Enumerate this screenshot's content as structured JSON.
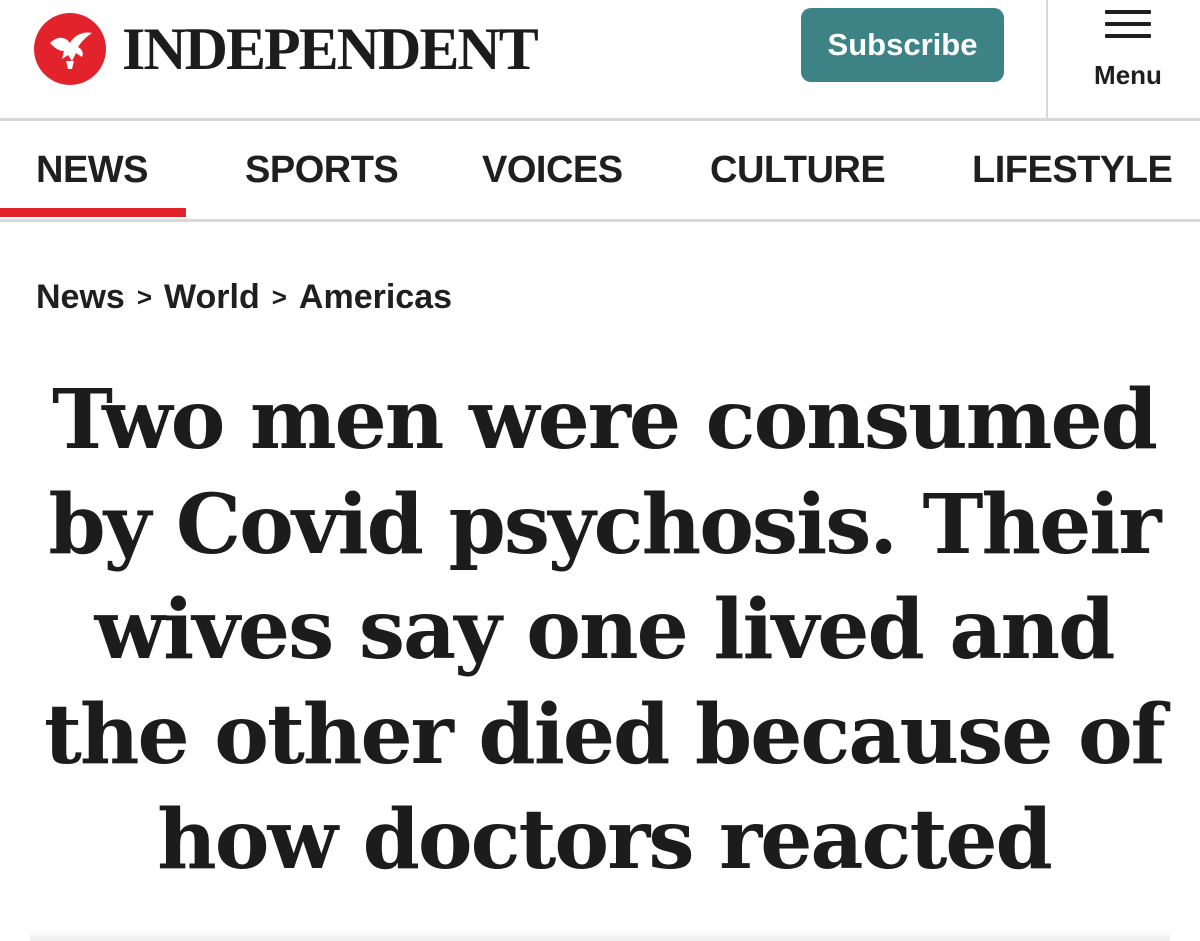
{
  "header": {
    "logo_text": "INDEPENDENT",
    "subscribe_label": "Subscribe",
    "menu_label": "Menu",
    "brand_color": "#e2232b",
    "subscribe_color": "#3d8285"
  },
  "nav": {
    "items": [
      {
        "label": "NEWS",
        "active": true
      },
      {
        "label": "SPORTS",
        "active": false
      },
      {
        "label": "VOICES",
        "active": false
      },
      {
        "label": "CULTURE",
        "active": false
      },
      {
        "label": "LIFESTYLE",
        "active": false
      }
    ]
  },
  "breadcrumb": {
    "items": [
      "News",
      "World",
      "Americas"
    ],
    "separator": ">"
  },
  "article": {
    "headline": "Two men were consumed by Covid psychosis. Their wives say one lived and the other died because of how doctors reacted"
  }
}
